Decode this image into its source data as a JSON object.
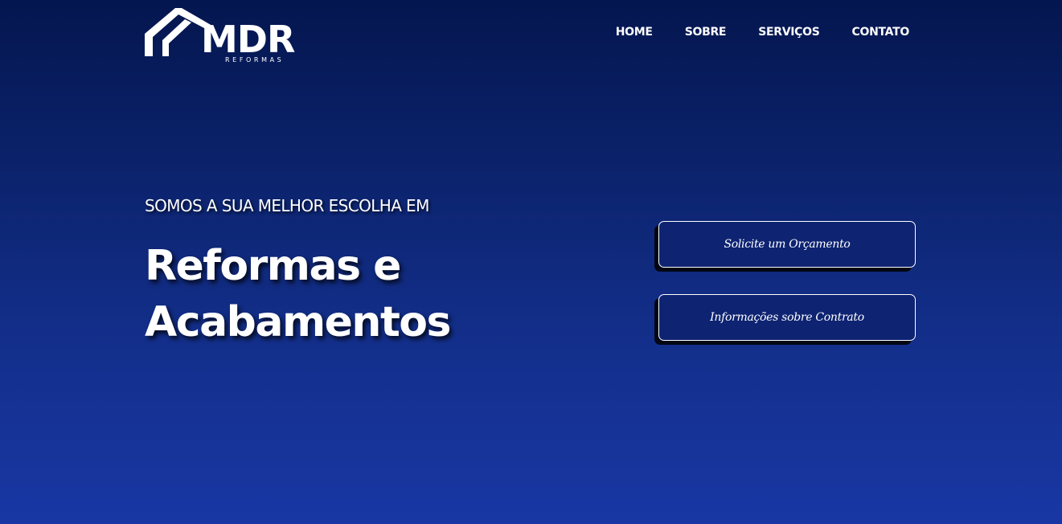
{
  "brand": {
    "name": "MDR",
    "subtitle": "REFORMAS"
  },
  "nav": {
    "items": [
      {
        "label": "HOME"
      },
      {
        "label": "SOBRE"
      },
      {
        "label": "SERVIÇOS"
      },
      {
        "label": "CONTATO"
      }
    ]
  },
  "hero": {
    "tagline": "SOMOS A SUA MELHOR ESCOLHA EM",
    "headline_line1": "Reformas e",
    "headline_line2": "Acabamentos"
  },
  "actions": {
    "quote_label": "Solicite um Orçamento",
    "contract_label": "Informações sobre Contrato"
  },
  "colors": {
    "background_top": "#04164f",
    "background_bottom": "#1937a4",
    "button_fill": "#0e2372",
    "text": "#ffffff"
  },
  "icons": {
    "logo": "house-roof-logo-icon"
  }
}
